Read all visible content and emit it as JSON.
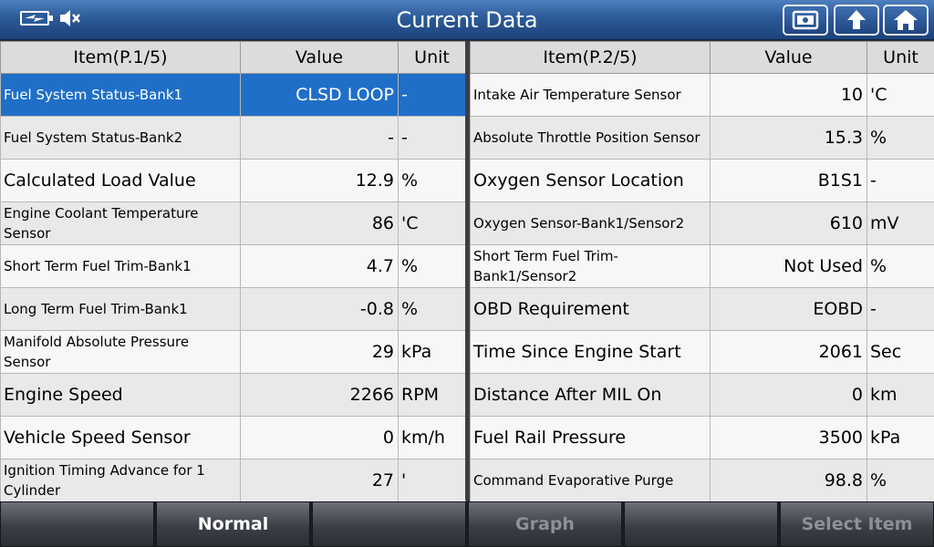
{
  "header": {
    "title": "Current Data",
    "icons": [
      "battery-icon",
      "mute-icon",
      "screenshot-icon",
      "back-icon",
      "home-icon"
    ]
  },
  "left_table": {
    "headers": [
      "Item(P.1/5)",
      "Value",
      "Unit"
    ],
    "rows": [
      {
        "item": "Fuel System Status-Bank1",
        "value": "CLSD LOOP",
        "unit": "-",
        "size": "sm",
        "selected": true
      },
      {
        "item": "Fuel System Status-Bank2",
        "value": "-",
        "unit": "-",
        "size": "sm"
      },
      {
        "item": "Calculated Load Value",
        "value": "12.9",
        "unit": "%",
        "size": "lg"
      },
      {
        "item": "Engine Coolant Temperature Sensor",
        "value": "86",
        "unit": "'C",
        "size": "sm"
      },
      {
        "item": "Short Term Fuel Trim-Bank1",
        "value": "4.7",
        "unit": "%",
        "size": "sm"
      },
      {
        "item": "Long Term Fuel Trim-Bank1",
        "value": "-0.8",
        "unit": "%",
        "size": "sm"
      },
      {
        "item": "Manifold Absolute Pressure Sensor",
        "value": "29",
        "unit": "kPa",
        "size": "sm"
      },
      {
        "item": "Engine Speed",
        "value": "2266",
        "unit": "RPM",
        "size": "lg"
      },
      {
        "item": "Vehicle Speed Sensor",
        "value": "0",
        "unit": "km/h",
        "size": "lg"
      },
      {
        "item": "Ignition Timing Advance for 1 Cylinder",
        "value": "27",
        "unit": "'",
        "size": "sm"
      }
    ]
  },
  "right_table": {
    "headers": [
      "Item(P.2/5)",
      "Value",
      "Unit"
    ],
    "rows": [
      {
        "item": "Intake Air Temperature Sensor",
        "value": "10",
        "unit": "'C",
        "size": "sm"
      },
      {
        "item": "Absolute Throttle Position Sensor",
        "value": "15.3",
        "unit": "%",
        "size": "sm"
      },
      {
        "item": "Oxygen Sensor Location",
        "value": "B1S1",
        "unit": "-",
        "size": "lg"
      },
      {
        "item": "Oxygen Sensor-Bank1/Sensor2",
        "value": "610",
        "unit": "mV",
        "size": "sm"
      },
      {
        "item": "Short Term Fuel Trim-Bank1/Sensor2",
        "value": "Not Used",
        "unit": "%",
        "size": "sm"
      },
      {
        "item": "OBD Requirement",
        "value": "EOBD",
        "unit": "-",
        "size": "lg"
      },
      {
        "item": "Time Since Engine Start",
        "value": "2061",
        "unit": "Sec",
        "size": "lg"
      },
      {
        "item": "Distance After MIL On",
        "value": "0",
        "unit": "km",
        "size": "lg"
      },
      {
        "item": "Fuel Rail Pressure",
        "value": "3500",
        "unit": "kPa",
        "size": "lg"
      },
      {
        "item": "Command Evaporative Purge",
        "value": "98.8",
        "unit": "%",
        "size": "sm"
      }
    ]
  },
  "footer": {
    "buttons": [
      {
        "label": "",
        "state": "blank"
      },
      {
        "label": "Normal",
        "state": "active"
      },
      {
        "label": "",
        "state": "blank"
      },
      {
        "label": "Graph",
        "state": "disabled"
      },
      {
        "label": "",
        "state": "blank"
      },
      {
        "label": "Select Item",
        "state": "disabled"
      }
    ]
  },
  "colors": {
    "title_bar": "#2c5a99",
    "selected_row": "#1f6fc8",
    "disabled_text": "#8d9099"
  }
}
